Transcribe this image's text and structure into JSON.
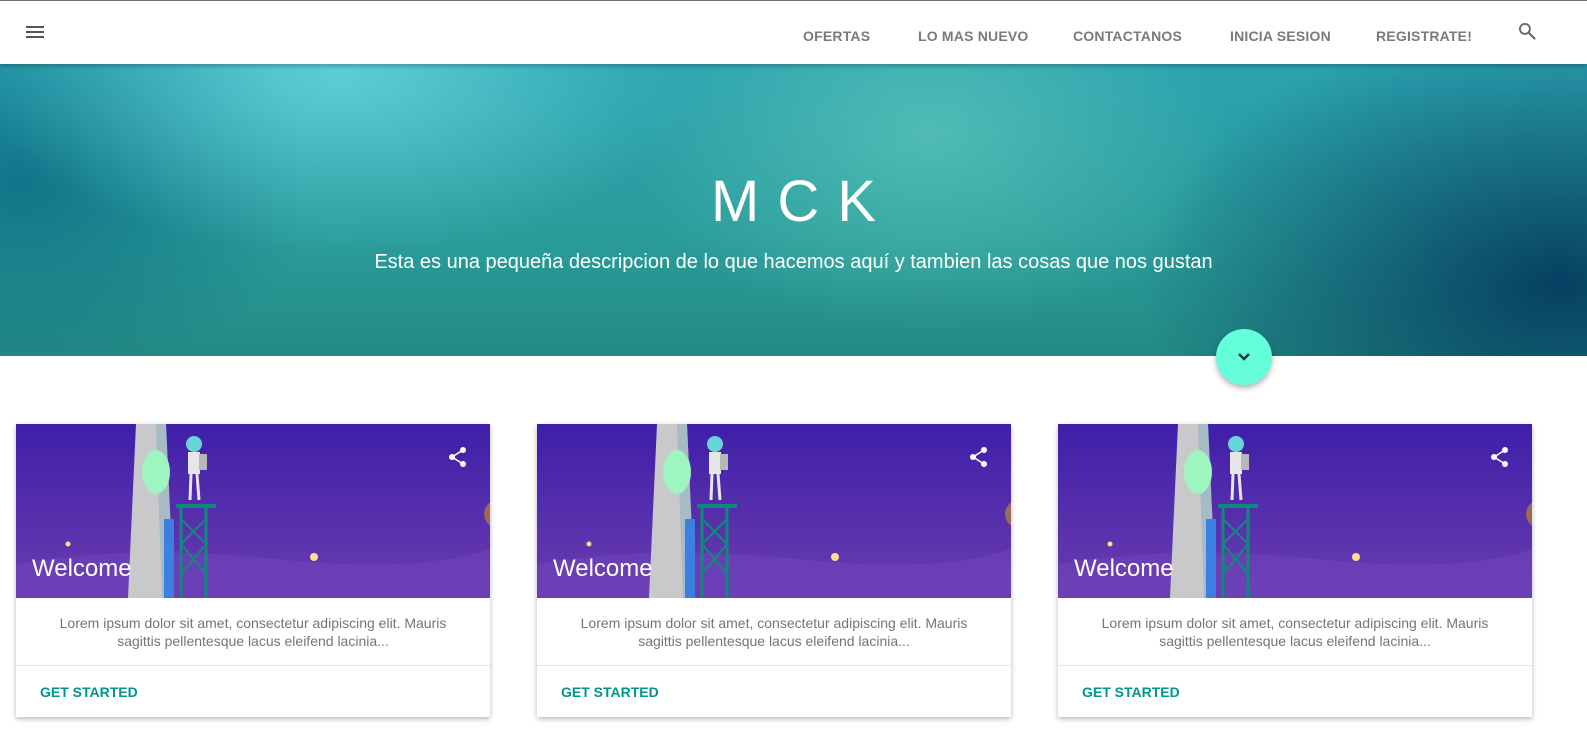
{
  "nav": {
    "links": [
      "OFERTAS",
      "LO MAS NUEVO",
      "CONTACTANOS",
      "INICIA SESION",
      "REGISTRATE!"
    ],
    "menu_icon": "hamburger-menu-icon",
    "search_icon": "search-icon"
  },
  "hero": {
    "title": "MCK",
    "subtitle": "Esta es una pequeña descripcion de lo que hacemos aquí y tambien las cosas que nos gustan",
    "fab_icon": "chevron-down-icon",
    "fab_color": "#64ffda"
  },
  "cards": [
    {
      "title": "Welcome",
      "text": "Lorem ipsum dolor sit amet, consectetur adipiscing elit. Mauris sagittis pellentesque lacus eleifend lacinia...",
      "action": "GET STARTED",
      "share_icon": "share-icon"
    },
    {
      "title": "Welcome",
      "text": "Lorem ipsum dolor sit amet, consectetur adipiscing elit. Mauris sagittis pellentesque lacus eleifend lacinia...",
      "action": "GET STARTED",
      "share_icon": "share-icon"
    },
    {
      "title": "Welcome",
      "text": "Lorem ipsum dolor sit amet, consectetur adipiscing elit. Mauris sagittis pellentesque lacus eleifend lacinia...",
      "action": "GET STARTED",
      "share_icon": "share-icon"
    }
  ],
  "colors": {
    "accent": "#00968a",
    "card_image_bg": "#4a1fa8"
  }
}
